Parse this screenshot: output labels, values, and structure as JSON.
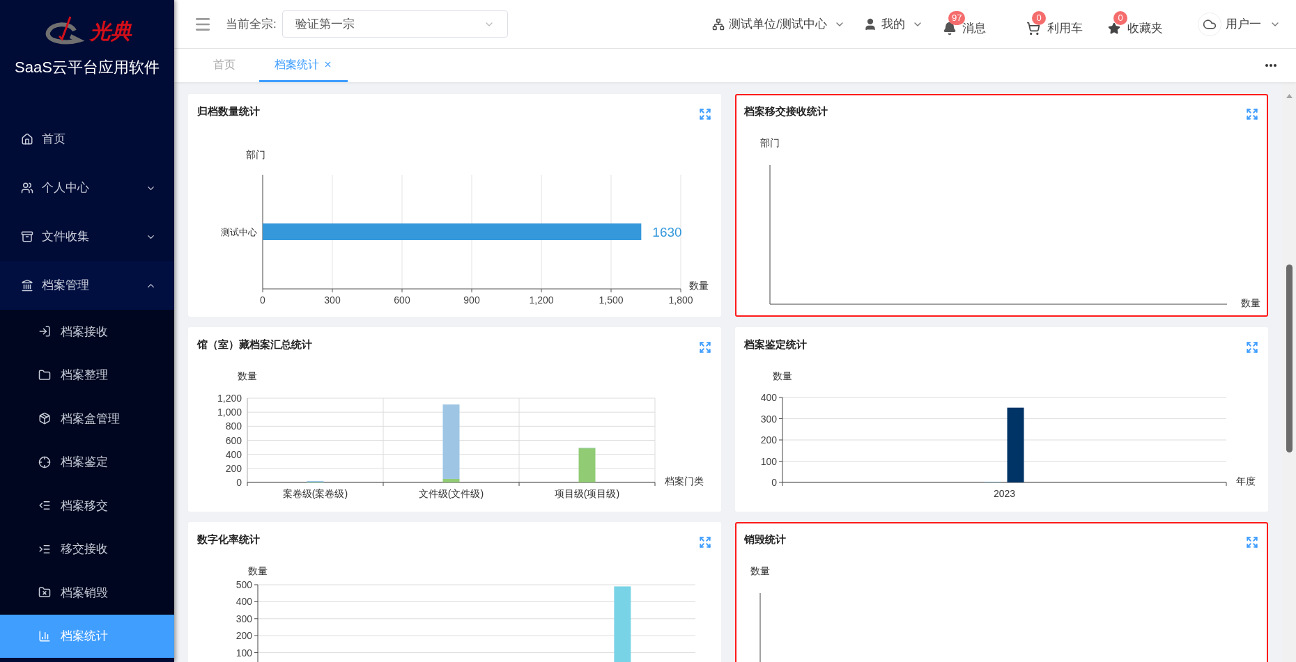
{
  "sidebar": {
    "logo_text": "光典",
    "title": "SaaS云平台应用软件",
    "items": [
      {
        "label": "首页"
      },
      {
        "label": "个人中心",
        "expanded": false
      },
      {
        "label": "文件收集",
        "expanded": false
      },
      {
        "label": "档案管理",
        "expanded": true,
        "children": [
          {
            "label": "档案接收",
            "selected": false
          },
          {
            "label": "档案整理",
            "selected": false
          },
          {
            "label": "档案盒管理",
            "selected": false
          },
          {
            "label": "档案鉴定",
            "selected": false
          },
          {
            "label": "档案移交",
            "selected": false
          },
          {
            "label": "移交接收",
            "selected": false
          },
          {
            "label": "档案销毁",
            "selected": false
          },
          {
            "label": "档案统计",
            "selected": true
          }
        ]
      }
    ]
  },
  "header": {
    "fonds_label": "当前全宗:",
    "fonds_value": "验证第一宗",
    "org": "测试单位/测试中心",
    "mine": "我的",
    "messages": {
      "label": "消息",
      "badge": "97"
    },
    "cart": {
      "label": "利用车",
      "badge": "0"
    },
    "favorites": {
      "label": "收藏夹",
      "badge": "0"
    },
    "user": "用户一"
  },
  "tabs": [
    {
      "label": "首页",
      "selected": false,
      "closable": false
    },
    {
      "label": "档案统计",
      "selected": true,
      "closable": true
    }
  ],
  "panels": [
    {
      "title": "归档数量统计",
      "highlighted": false,
      "chart_data": {
        "type": "bar",
        "orientation": "horizontal",
        "grid": true,
        "xlabel": "数量",
        "ylabel": "部门",
        "categories": [
          "测试中心"
        ],
        "series": [
          {
            "color": "#3498db",
            "values": [
              1630
            ]
          }
        ],
        "xlim": [
          0,
          1800
        ],
        "xticks": [
          0,
          300,
          600,
          900,
          {
            "value": 1200,
            "label": "1,200"
          },
          {
            "value": 1500,
            "label": "1,500"
          },
          {
            "value": 1800,
            "label": "1,800"
          }
        ],
        "data_labels": true
      }
    },
    {
      "title": "档案移交接收统计",
      "highlighted": true,
      "ylabel": "部门",
      "xlabel": "数量"
    },
    {
      "title": "馆（室）藏档案汇总统计",
      "highlighted": false,
      "chart_data": {
        "type": "bar",
        "grid": true,
        "xlabel": "档案门类",
        "ylabel": "数量",
        "categories": [
          "案卷级(案卷级)",
          "文件级(文件级)",
          "项目级(项目级)"
        ],
        "series": [
          {
            "color": "#91cb74",
            "values": [
              0,
              50,
              490
            ]
          },
          {
            "color": "#9ec5e3",
            "values": [
              20,
              1060,
              0
            ]
          }
        ],
        "stacked": true,
        "ylim": [
          0,
          1200
        ],
        "yticks": [
          0,
          200,
          400,
          600,
          800,
          {
            "value": 1000,
            "label": "1,000"
          },
          {
            "value": 1200,
            "label": "1,200"
          }
        ]
      }
    },
    {
      "title": "档案鉴定统计",
      "highlighted": false,
      "chart_data": {
        "type": "bar",
        "grid": true,
        "xlabel": "年度",
        "ylabel": "数量",
        "categories": [
          "2023"
        ],
        "series": [
          {
            "color": "#73c0de",
            "values": [
              2
            ]
          },
          {
            "color": "#003366",
            "values": [
              352
            ]
          }
        ],
        "ylim": [
          0,
          400
        ],
        "yticks": [
          0,
          100,
          200,
          300,
          400
        ]
      }
    },
    {
      "title": "数字化率统计",
      "highlighted": false,
      "chart_data": {
        "type": "bar",
        "grid": true,
        "ylabel": "数量",
        "series": [
          {
            "color": "#78d3e6",
            "values": [
              null,
              null,
              490
            ]
          }
        ],
        "ylim": [
          0,
          500
        ],
        "yticks": [
          100,
          200,
          300,
          400,
          500
        ]
      }
    },
    {
      "title": "销毁统计",
      "highlighted": true,
      "ylabel": "数量"
    }
  ]
}
